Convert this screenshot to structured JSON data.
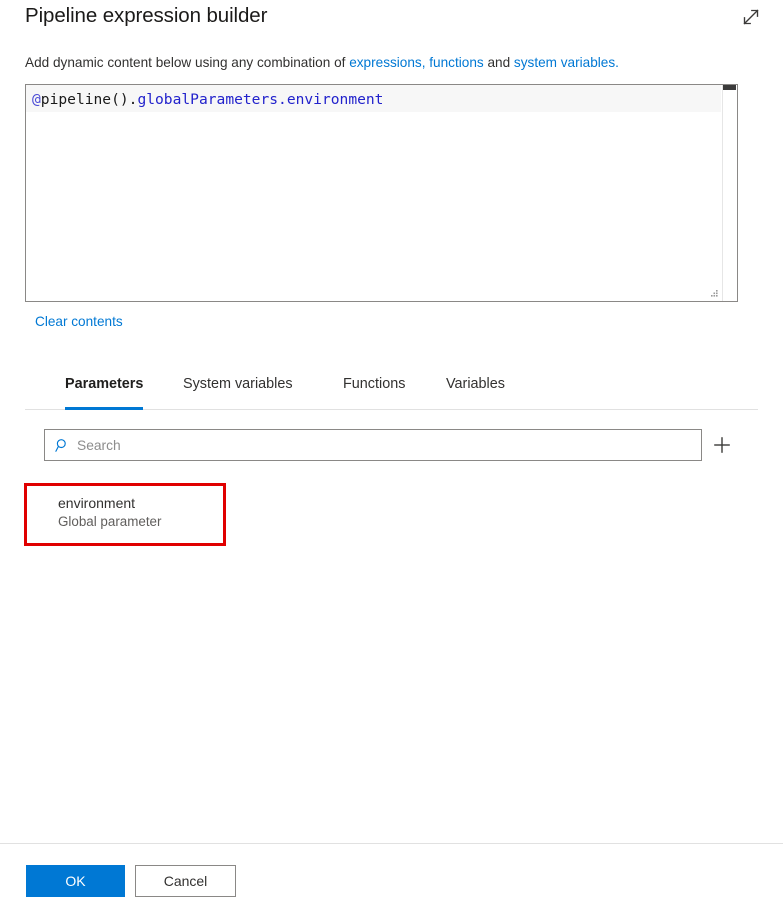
{
  "header": {
    "title": "Pipeline expression builder",
    "expand_icon": "expand-diagonal-arrows-icon"
  },
  "subtitle": {
    "text_start": "Add dynamic content below using any combination of ",
    "link1": "expressions, functions",
    "text_middle": " and ",
    "link2": "system variables."
  },
  "editor": {
    "expression_full": "@pipeline().globalParameters.environment",
    "tokens": {
      "at": "@",
      "func": "pipeline().",
      "property": "globalParameters.environment"
    }
  },
  "clear_contents": {
    "label": "Clear contents"
  },
  "tabs": [
    {
      "label": "Parameters",
      "active": true
    },
    {
      "label": "System variables",
      "active": false
    },
    {
      "label": "Functions",
      "active": false
    },
    {
      "label": "Variables",
      "active": false
    }
  ],
  "search": {
    "placeholder": "Search",
    "value": "",
    "icon": "search-magnifier-icon"
  },
  "add_button": {
    "icon": "plus-icon",
    "label": "+"
  },
  "parameter_item": {
    "name": "environment",
    "subtitle": "Global parameter",
    "highlight_color": "#e00000"
  },
  "footer": {
    "ok_label": "OK",
    "cancel_label": "Cancel"
  },
  "colors": {
    "accent": "#0078d4",
    "link": "#0078d4",
    "highlight": "#e00000",
    "text": "#323130",
    "muted": "#605e5c",
    "token_at": "#4b4bd6",
    "token_property": "#2222cc"
  }
}
